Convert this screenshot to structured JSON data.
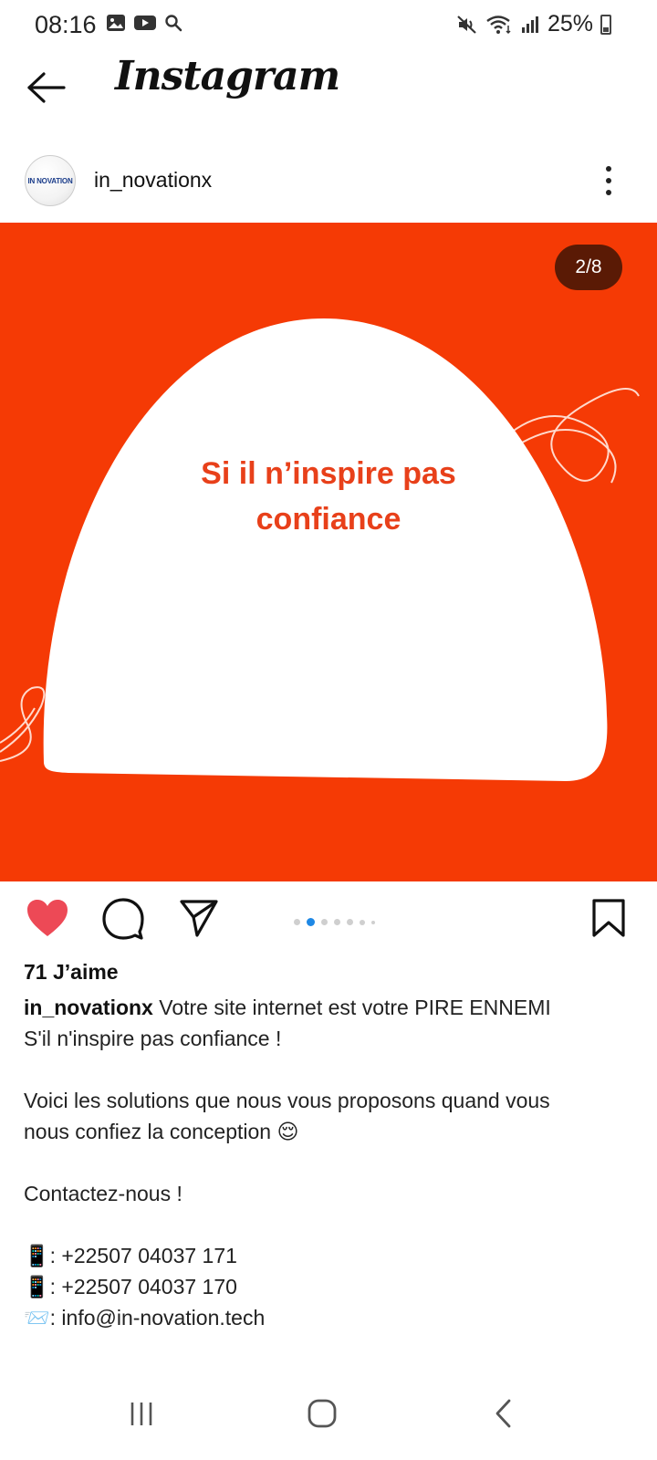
{
  "status_bar": {
    "time": "08:16",
    "battery": "25%",
    "left_icons": [
      "gallery-icon",
      "youtube-icon",
      "search-icon"
    ],
    "right_icons": [
      "mute-icon",
      "wifi-icon",
      "signal-icon",
      "battery-icon"
    ]
  },
  "app": {
    "title": "Instagram",
    "back_icon": "back-arrow-icon"
  },
  "post": {
    "username": "in_novationx",
    "avatar_label": "IN NOVATION",
    "more_icon": "more-vertical-icon",
    "carousel": {
      "counter": "2/8",
      "slide_text_line1": "Si il n’inspire pas",
      "slide_text_line2": "confiance",
      "background_color": "#f53a05",
      "current_index": 2,
      "total": 8
    },
    "actions": {
      "like_icon": "heart-filled-icon",
      "comment_icon": "comment-icon",
      "share_icon": "send-icon",
      "save_icon": "bookmark-icon",
      "like_color": "#ed4956",
      "dot_active_color": "#1e88e5"
    },
    "likes": "71 J’aime",
    "caption": {
      "user": "in_novationx",
      "line1": "Votre site internet est votre PIRE ENNEMI",
      "line2": "S'il n'inspire pas confiance !",
      "line3": "Voici les solutions que nous vous proposons quand vous",
      "line4": "nous confiez la conception 😌",
      "line5": "Contactez-nous !",
      "phone1": ": +22507 04037 171",
      "phone2": ": +22507 04037 170",
      "email": ": info@in-novation.tech",
      "phone_icon": "📱",
      "email_icon": "📨"
    }
  },
  "navbar": {
    "recents_icon": "recent-apps-icon",
    "home_icon": "home-icon",
    "back_icon": "system-back-icon"
  }
}
